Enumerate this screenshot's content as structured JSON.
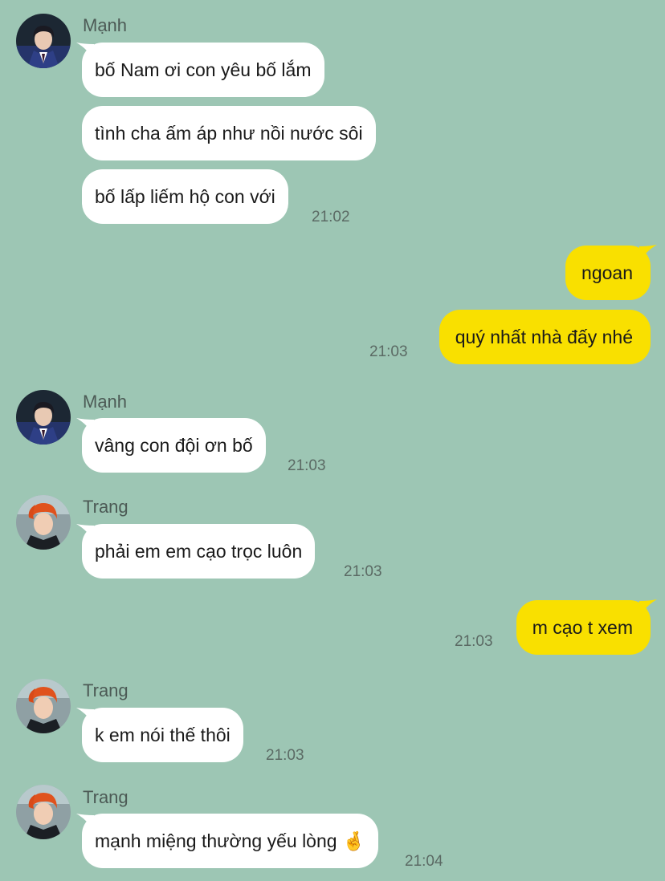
{
  "colors": {
    "background": "#9dc6b4",
    "incoming_bubble": "#ffffff",
    "outgoing_bubble": "#f9e000",
    "timestamp": "#5b6a64",
    "sender_name": "#4c5a55"
  },
  "messages": [
    {
      "sender": "Mạnh",
      "avatar": "avatar-manh"
    },
    {
      "text": "bố Nam ơi con yêu bố lắm"
    },
    {
      "text": "tình cha ấm áp như nồi nước sôi"
    },
    {
      "text": "bố lấp liếm hộ con với",
      "time": "21:02"
    },
    {
      "text": "ngoan"
    },
    {
      "text": "quý nhất nhà đấy nhé",
      "time": "21:03"
    },
    {
      "sender": "Mạnh",
      "avatar": "avatar-manh"
    },
    {
      "text": "vâng con đội ơn bố",
      "time": "21:03"
    },
    {
      "sender": "Trang",
      "avatar": "avatar-trang"
    },
    {
      "text": "phải em em cạo trọc luôn",
      "time": "21:03"
    },
    {
      "text": "m cạo t xem",
      "time": "21:03"
    },
    {
      "sender": "Trang",
      "avatar": "avatar-trang"
    },
    {
      "text": "k em nói thế thôi",
      "time": "21:03"
    },
    {
      "sender": "Trang",
      "avatar": "avatar-trang"
    },
    {
      "text": "mạnh miệng thường yếu lòng",
      "emoji": "🤞",
      "time": "21:04"
    }
  ]
}
